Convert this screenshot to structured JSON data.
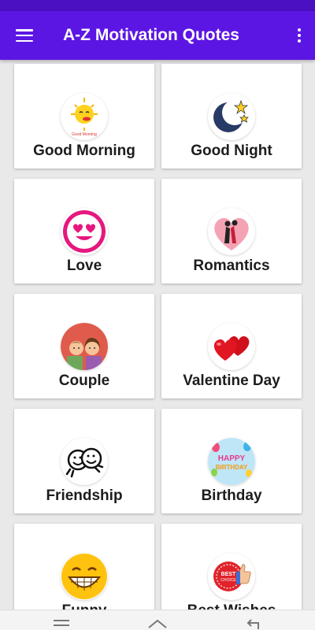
{
  "app": {
    "title": "A-Z Motivation Quotes"
  },
  "colors": {
    "appbar": "#5b16e3",
    "statusbar": "#4a10c2"
  },
  "header": {
    "menu_icon": "hamburger-icon",
    "more_icon": "more-vert-icon"
  },
  "categories": [
    {
      "label": "Good Morning",
      "icon": "sun-icon",
      "icon_text": "Good Morning"
    },
    {
      "label": "Good Night",
      "icon": "moon-stars-icon"
    },
    {
      "label": "Love",
      "icon": "heart-eyes-emoji-icon"
    },
    {
      "label": "Romantics",
      "icon": "couple-heart-icon"
    },
    {
      "label": "Couple",
      "icon": "couple-icon"
    },
    {
      "label": "Valentine Day",
      "icon": "two-hearts-icon"
    },
    {
      "label": "Friendship",
      "icon": "friends-faces-icon"
    },
    {
      "label": "Birthday",
      "icon": "birthday-balloons-icon",
      "icon_text": [
        "HAPPY",
        "BIRTHDAY"
      ]
    },
    {
      "label": "Funny",
      "icon": "grinning-face-icon"
    },
    {
      "label": "Best Wishes",
      "icon": "thumbs-up-badge-icon",
      "icon_text": [
        "BEST",
        "CHOICE"
      ]
    }
  ],
  "navbar": {
    "icons": [
      "menu-icon",
      "home-icon",
      "back-icon"
    ]
  }
}
